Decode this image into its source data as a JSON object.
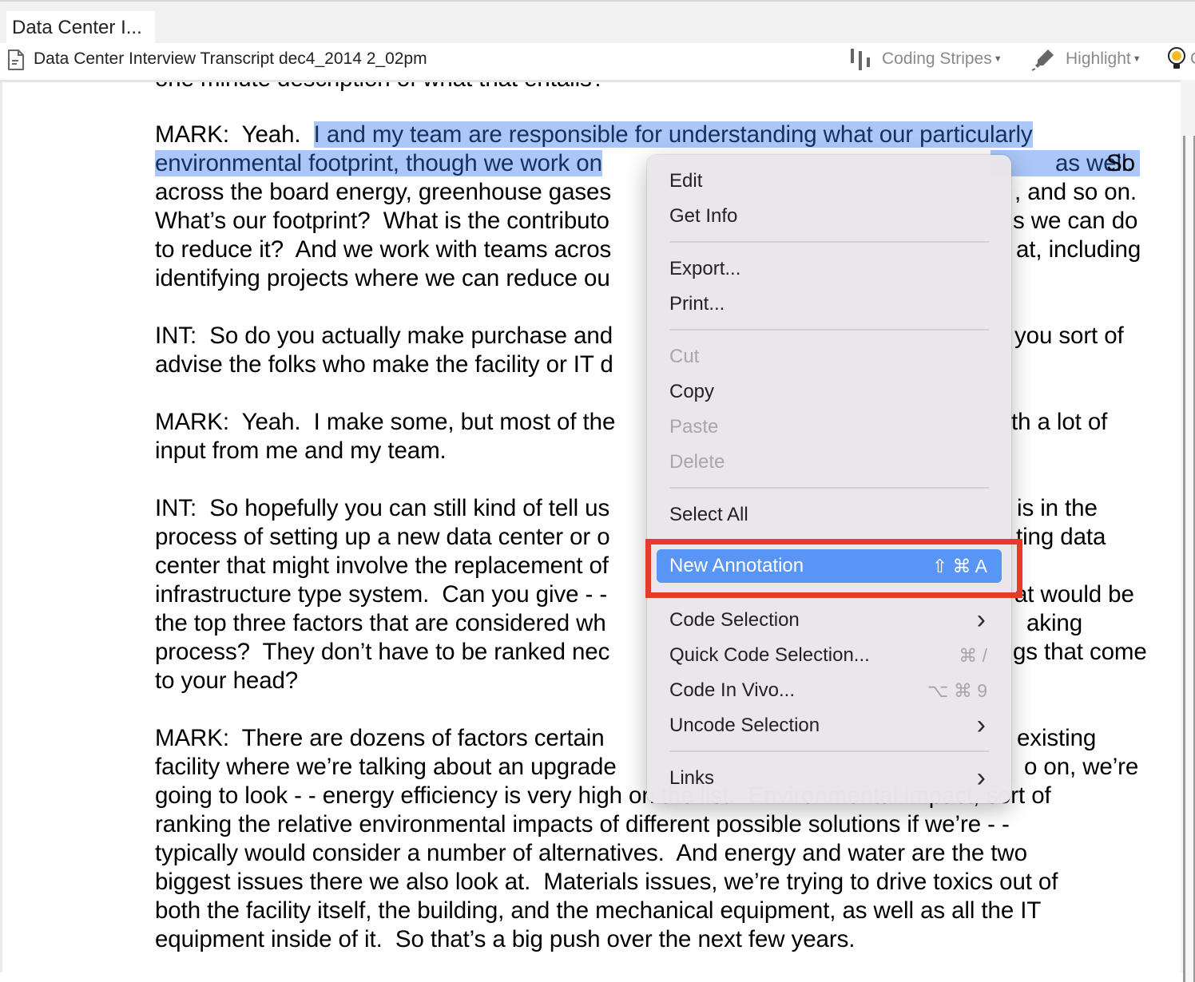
{
  "window": {
    "tab_label": "Data Center I...",
    "document_title": "Data Center Interview Transcript dec4_2014 2_02pm"
  },
  "toolbar": {
    "coding_stripes_label": "Coding Stripes",
    "highlight_label": "Highlight",
    "partial_label": "C",
    "icons": [
      "coding-stripes-icon",
      "highlighter-icon",
      "lightbulb-icon"
    ]
  },
  "selection_color": "#aac7f8",
  "document": {
    "lines": [
      {
        "left": "one minute description of what that entails?",
        "right": "",
        "pre": "",
        "selected": "",
        "post": ""
      },
      {
        "left": "",
        "right": "",
        "pre": "MARK:  Yeah.  ",
        "selected": "I and my team are responsible for understanding what our particularly",
        "post": ""
      },
      {
        "left": "",
        "right": "So",
        "pre": "",
        "selected": "environmental footprint, though we work on",
        "selected_right": "as well.",
        "post": ""
      },
      {
        "left": "across the board energy, greenhouse gases",
        "right": ", and so on."
      },
      {
        "left": "What’s our footprint?  What is the contributo",
        "right": "s we can do"
      },
      {
        "left": "to reduce it?  And we work with teams acros",
        "right": "at, including"
      },
      {
        "left": "identifying projects where we can reduce ou",
        "right": ""
      },
      {
        "left": "",
        "right": ""
      },
      {
        "left": "INT:  So do you actually make purchase and",
        "right": "you sort of"
      },
      {
        "left": "advise the folks who make the facility or IT d",
        "right": ""
      },
      {
        "left": "",
        "right": ""
      },
      {
        "left": "MARK:  Yeah.  I make some, but most of the",
        "right": "th a lot of"
      },
      {
        "left": "input from me and my team.",
        "right": ""
      },
      {
        "left": "",
        "right": ""
      },
      {
        "left": "INT:  So hopefully you can still kind of tell us",
        "right": "is in the"
      },
      {
        "left": "process of setting up a new data center or o",
        "right": "ting data"
      },
      {
        "left": "center that might involve the replacement of",
        "right": ""
      },
      {
        "left": "infrastructure type system.  Can you give - -",
        "right": "at would be"
      },
      {
        "left": "the top three factors that are considered wh",
        "right": "aking"
      },
      {
        "left": "process?  They don’t have to be ranked nec",
        "right": "gs that come"
      },
      {
        "left": "to your head?",
        "right": ""
      },
      {
        "left": "",
        "right": ""
      },
      {
        "left": "MARK:  There are dozens of factors certain",
        "right": "existing"
      },
      {
        "left": "facility where we’re talking about an upgrade",
        "right": "o on, we’re"
      },
      {
        "left": "going to look - - energy efficiency is very high on the list.  Environmental impact, sort of",
        "right": ""
      },
      {
        "left": "ranking the relative environmental impacts of different possible solutions if we’re - -",
        "right": ""
      },
      {
        "left": "typically would consider a number of alternatives.  And energy and water are the two",
        "right": ""
      },
      {
        "left": "biggest issues there we also look at.  Materials issues, we’re trying to drive toxics out of",
        "right": ""
      },
      {
        "left": "both the facility itself, the building, and the mechanical equipment, as well as all the IT",
        "right": ""
      },
      {
        "left": "equipment inside of it.  So that’s a big push over the next few years.",
        "right": ""
      }
    ]
  },
  "context_menu": {
    "items": [
      {
        "label": "Edit",
        "enabled": true
      },
      {
        "label": "Get Info",
        "enabled": true
      },
      {
        "separator": true
      },
      {
        "label": "Export...",
        "enabled": true
      },
      {
        "label": "Print...",
        "enabled": true
      },
      {
        "separator": true
      },
      {
        "label": "Cut",
        "enabled": false
      },
      {
        "label": "Copy",
        "enabled": true
      },
      {
        "label": "Paste",
        "enabled": false
      },
      {
        "label": "Delete",
        "enabled": false
      },
      {
        "separator": true
      },
      {
        "label": "Select All",
        "enabled": true
      },
      {
        "separator": true
      },
      {
        "label": "New Annotation",
        "enabled": true,
        "highlighted": true,
        "shortcut": "⇧⌘A"
      },
      {
        "separator": true
      },
      {
        "label": "Code Selection",
        "enabled": true,
        "submenu": true
      },
      {
        "label": "Quick Code Selection...",
        "enabled": true,
        "shortcut": "⌘ /"
      },
      {
        "label": "Code In Vivo...",
        "enabled": true,
        "shortcut": "⌥⌘9"
      },
      {
        "label": "Uncode Selection",
        "enabled": true,
        "submenu": true
      },
      {
        "separator": true
      },
      {
        "label": "Links",
        "enabled": true,
        "submenu": true
      }
    ],
    "highlight_color": "#5995f4",
    "callout_border_color": "#e63a2a"
  }
}
